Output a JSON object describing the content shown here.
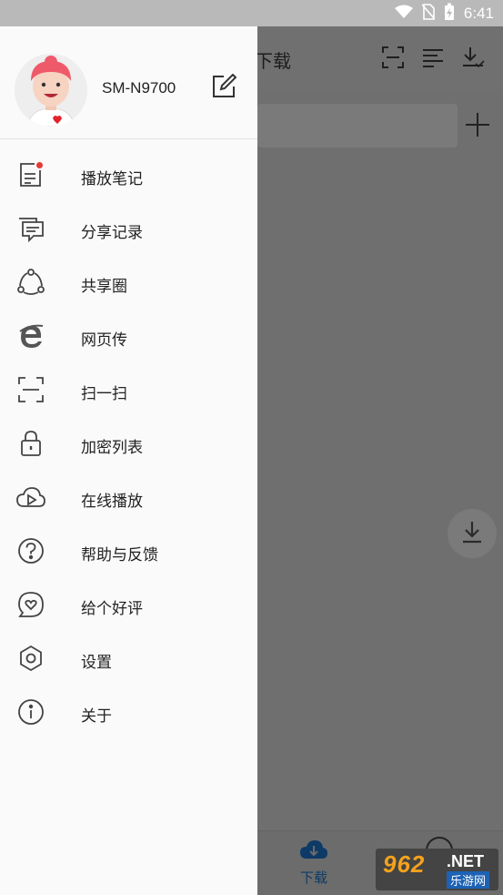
{
  "status_bar": {
    "time": "6:41"
  },
  "background_app": {
    "toolbar_title": "下载",
    "bottom_nav": {
      "download_label": "下载"
    }
  },
  "drawer": {
    "device_name": "SM-N9700",
    "menu": [
      {
        "label": "播放笔记",
        "icon": "note-icon"
      },
      {
        "label": "分享记录",
        "icon": "chat-icon"
      },
      {
        "label": "共享圈",
        "icon": "share-circle-icon"
      },
      {
        "label": "网页传",
        "icon": "ie-icon"
      },
      {
        "label": "扫一扫",
        "icon": "scan-icon"
      },
      {
        "label": "加密列表",
        "icon": "lock-icon"
      },
      {
        "label": "在线播放",
        "icon": "cloud-play-icon"
      },
      {
        "label": "帮助与反馈",
        "icon": "help-icon"
      },
      {
        "label": "给个好评",
        "icon": "heart-bubble-icon"
      },
      {
        "label": "设置",
        "icon": "settings-icon"
      },
      {
        "label": "关于",
        "icon": "info-icon"
      }
    ]
  },
  "watermark": {
    "brand": "962",
    "net": ".NET",
    "sub": "乐游网"
  }
}
